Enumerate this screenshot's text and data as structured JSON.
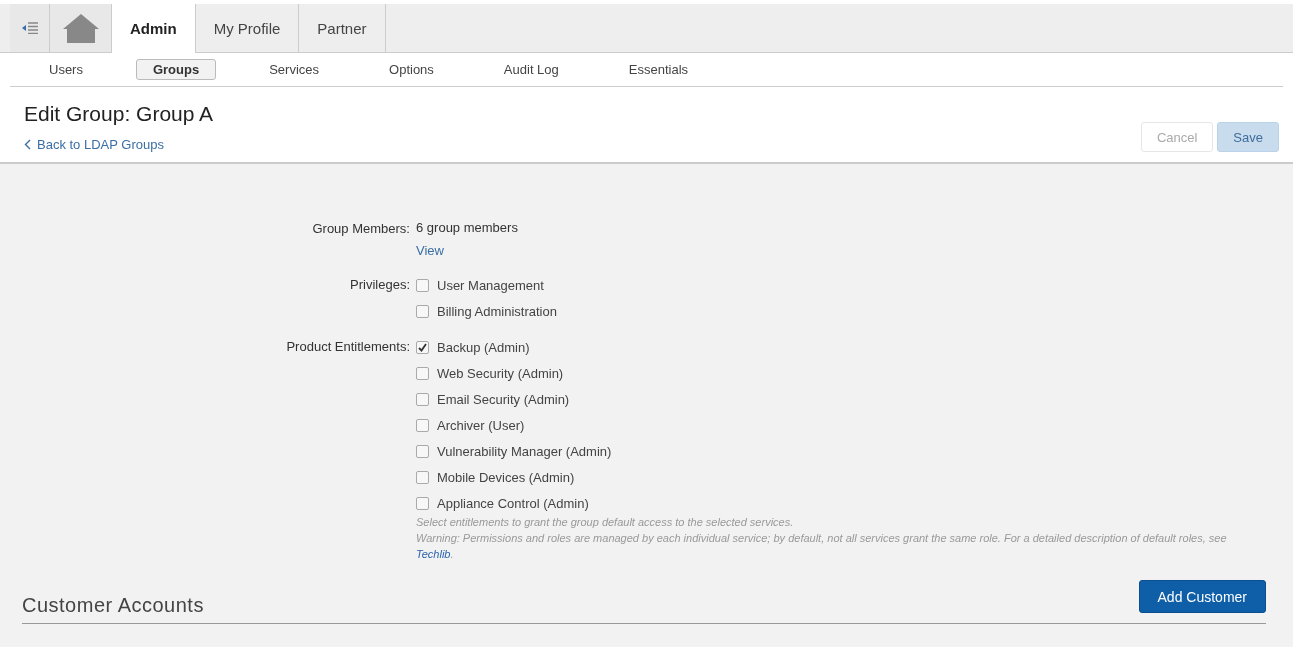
{
  "top_tabs": [
    {
      "label": "Admin",
      "selected": true
    },
    {
      "label": "My Profile",
      "selected": false
    },
    {
      "label": "Partner",
      "selected": false
    }
  ],
  "sub_tabs": [
    {
      "label": "Users",
      "selected": false
    },
    {
      "label": "Groups",
      "selected": true
    },
    {
      "label": "Services",
      "selected": false
    },
    {
      "label": "Options",
      "selected": false
    },
    {
      "label": "Audit Log",
      "selected": false
    },
    {
      "label": "Essentials",
      "selected": false
    }
  ],
  "page": {
    "title": "Edit Group: Group A",
    "back_link": "Back to LDAP Groups",
    "buttons": [
      {
        "label": "Cancel",
        "kind": "secondary",
        "disabled": true
      },
      {
        "label": "Save",
        "kind": "primary",
        "disabled": true
      }
    ]
  },
  "group_members": {
    "label": "Group Members:",
    "value": "6 group members",
    "link": "View"
  },
  "privileges": {
    "label": "Privileges:",
    "items": [
      {
        "label": "User Management",
        "checked": false
      },
      {
        "label": "Billing Administration",
        "checked": false
      }
    ]
  },
  "product_entitlements": {
    "label": "Product Entitlements:",
    "items": [
      {
        "label": "Backup (Admin)",
        "checked": true
      },
      {
        "label": "Web Security (Admin)",
        "checked": false
      },
      {
        "label": "Email Security (Admin)",
        "checked": false
      },
      {
        "label": "Archiver (User)",
        "checked": false
      },
      {
        "label": "Vulnerability Manager (Admin)",
        "checked": false
      },
      {
        "label": "Mobile Devices (Admin)",
        "checked": false
      },
      {
        "label": "Appliance Control (Admin)",
        "checked": false
      }
    ],
    "hint": "Select entitlements to grant the group default access to the selected services.",
    "warning": "Warning: Permissions and roles are managed by each individual service; by default, not all services grant the same role. For a detailed description of default roles, see ",
    "warning_link": "Techlib",
    "warning_end": "."
  },
  "customer_accounts": {
    "title": "Customer Accounts",
    "button": "Add Customer"
  }
}
